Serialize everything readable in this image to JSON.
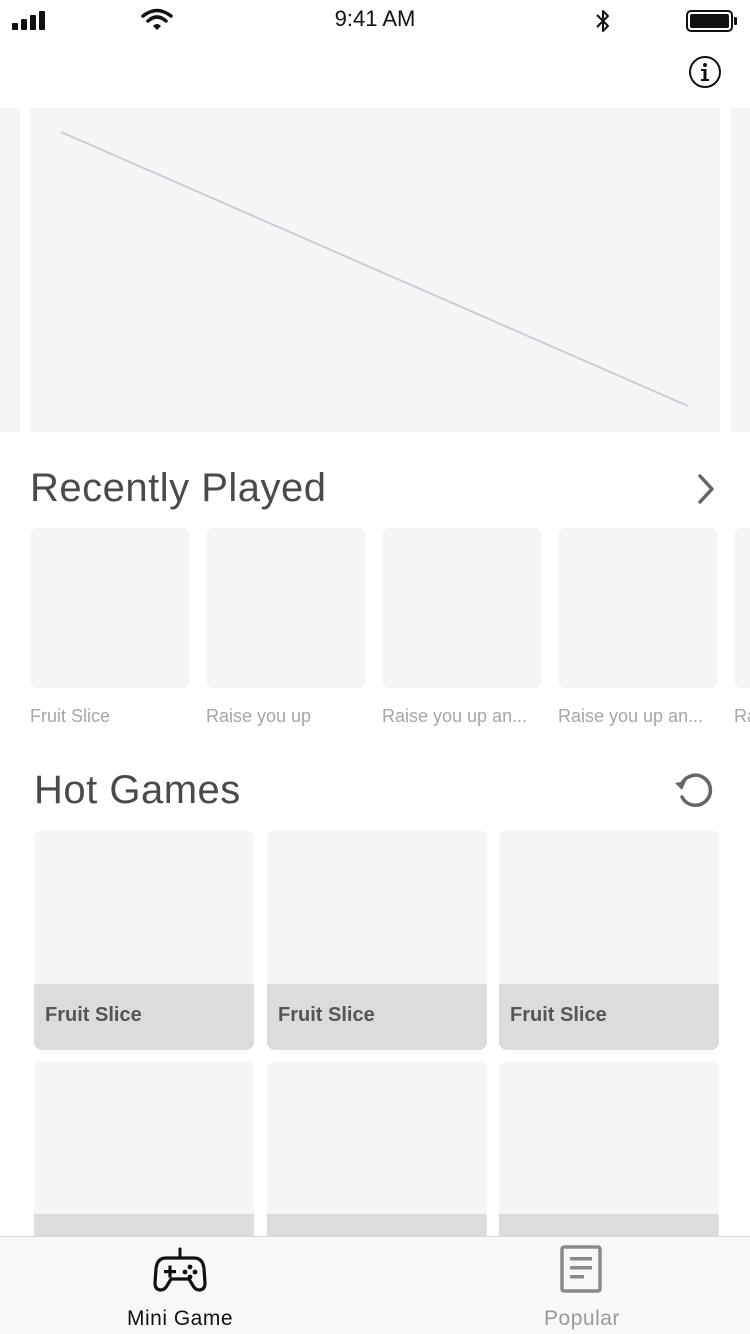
{
  "status_bar": {
    "time": "9:41 AM",
    "icons": [
      "signal-icon",
      "wifi-icon",
      "bluetooth-icon",
      "battery-icon"
    ]
  },
  "header": {
    "info_icon": "info-icon"
  },
  "banner": {
    "placeholder": "image-placeholder"
  },
  "recently_played": {
    "title": "Recently Played",
    "more_icon": "chevron-right-icon",
    "items": [
      {
        "label": "Fruit Slice"
      },
      {
        "label": "Raise you up"
      },
      {
        "label": "Raise you up an..."
      },
      {
        "label": "Raise you up an..."
      },
      {
        "label": "Ra"
      }
    ]
  },
  "hot_games": {
    "title": "Hot Games",
    "refresh_icon": "refresh-icon",
    "items": [
      {
        "label": "Fruit Slice"
      },
      {
        "label": "Fruit Slice"
      },
      {
        "label": "Fruit Slice"
      },
      {
        "label": ""
      },
      {
        "label": ""
      },
      {
        "label": ""
      }
    ]
  },
  "tab_bar": {
    "tabs": [
      {
        "label": "Mini Game",
        "icon": "gamepad-icon",
        "active": true
      },
      {
        "label": "Popular",
        "icon": "document-icon",
        "active": false
      }
    ]
  },
  "colors": {
    "placeholder": "#f5f5f5",
    "caption_bg": "#dcdcdc",
    "title_text": "#4a4a4a",
    "muted_text": "#a6a6a6",
    "tab_inactive": "#9a9a9a"
  }
}
